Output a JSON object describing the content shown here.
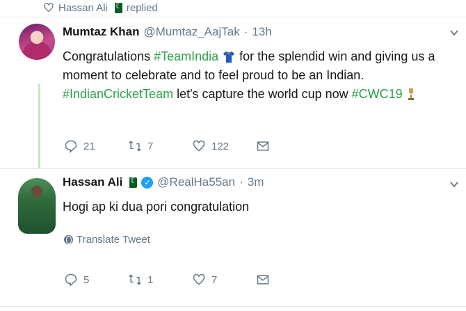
{
  "context": {
    "icon": "heart-outline-icon",
    "user": "Hassan Ali",
    "badge": "pakistan-flag-icon",
    "action": "replied"
  },
  "tweets": [
    {
      "name": "Mumtaz Khan",
      "handle": "@Mumtaz_AajTak",
      "separator": "·",
      "time": "13h",
      "text_parts": [
        "Congratulations ",
        "#TeamIndia",
        " for the splendid win and giving us a moment to celebrate and to feel proud to be an Indian. ",
        "#IndianCricketTeam",
        " let's capture the world cup now ",
        "#CWC19"
      ],
      "emoji": [
        "shirt-icon",
        "trophy-icon"
      ],
      "stats": {
        "replies": "21",
        "retweets": "7",
        "likes": "122"
      }
    },
    {
      "name": "Hassan Ali",
      "handle": "@RealHa55an",
      "separator": "·",
      "time": "3m",
      "text": "Hogi ap ki dua pori congratulation",
      "translate": "Translate Tweet",
      "stats": {
        "replies": "5",
        "retweets": "1",
        "likes": "7"
      }
    }
  ],
  "colors": {
    "hashtag": "#2aa14a",
    "verified": "#1da1f2",
    "muted": "#657786"
  }
}
